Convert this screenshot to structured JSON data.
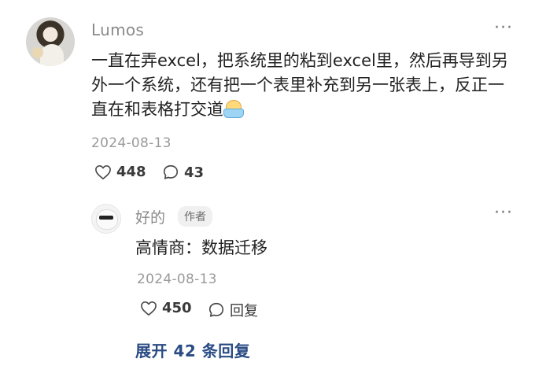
{
  "comment": {
    "username": "Lumos",
    "text": "一直在弄excel，把系统里的粘到excel里，然后再导到另外一个系统，还有把一个表里补充到另一张表上，反正一直在和表格打交道",
    "emoji_icon": "bathing-emoji-icon",
    "date": "2024-08-13",
    "likes": "448",
    "comments": "43",
    "more_label": "···"
  },
  "reply": {
    "username": "好的",
    "badge": "作者",
    "text": "高情商：数据迁移",
    "date": "2024-08-13",
    "likes": "450",
    "reply_label": "回复",
    "more_label": "···"
  },
  "expand_label": "展开 42 条回复",
  "colors": {
    "link": "#2a4b84",
    "muted": "#8a8a8a",
    "text": "#222222"
  }
}
